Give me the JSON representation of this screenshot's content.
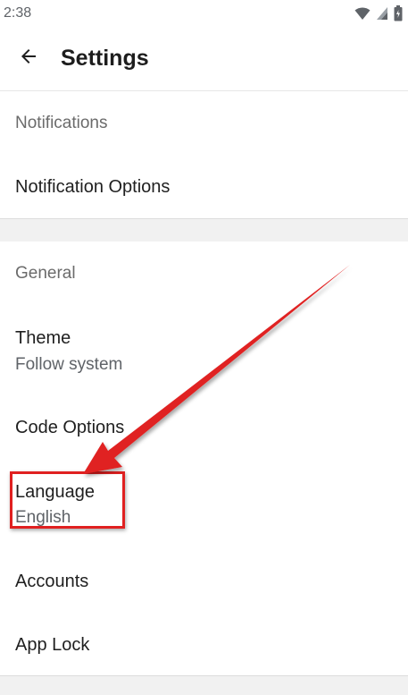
{
  "status_bar": {
    "time": "2:38",
    "icons": [
      "wifi-icon",
      "signal-icon",
      "battery-icon"
    ]
  },
  "app_bar": {
    "back_icon": "arrow-left-icon",
    "title": "Settings"
  },
  "sections": {
    "notifications": {
      "header": "Notifications",
      "items": [
        {
          "title": "Notification Options"
        }
      ]
    },
    "general": {
      "header": "General",
      "items": [
        {
          "title": "Theme",
          "subtitle": "Follow system"
        },
        {
          "title": "Code Options"
        },
        {
          "title": "Language",
          "subtitle": "English"
        },
        {
          "title": "Accounts"
        },
        {
          "title": "App Lock"
        }
      ]
    }
  },
  "annotation": {
    "arrow_color": "#e02020",
    "highlight_color": "#e02020",
    "highlighted_item": "Language"
  }
}
